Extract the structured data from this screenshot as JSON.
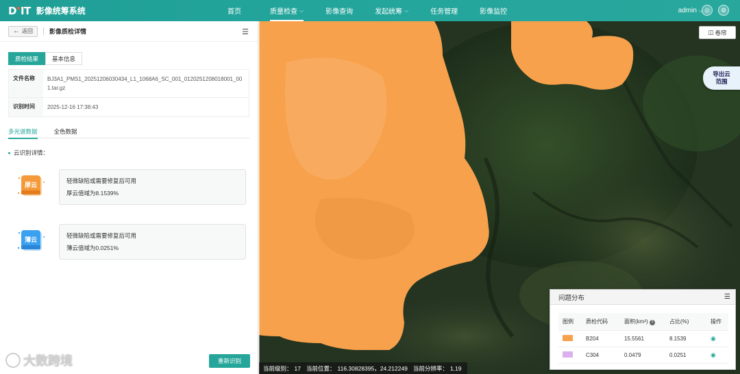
{
  "header": {
    "logo_text": "DIT",
    "app_title": "影像统筹系统",
    "nav": [
      {
        "label": "首页",
        "has_dropdown": false,
        "active": false
      },
      {
        "label": "质量检查",
        "has_dropdown": true,
        "active": true
      },
      {
        "label": "影像查询",
        "has_dropdown": false,
        "active": false
      },
      {
        "label": "发起统筹",
        "has_dropdown": true,
        "active": false
      },
      {
        "label": "任务管理",
        "has_dropdown": false,
        "active": false
      },
      {
        "label": "影像监控",
        "has_dropdown": false,
        "active": false
      }
    ],
    "user": "admin",
    "icons": [
      "message-icon",
      "settings-icon"
    ]
  },
  "left_panel": {
    "back_label": "返回",
    "title": "影像质检详情",
    "tabs": [
      "质检结果",
      "基本信息"
    ],
    "active_tab": "质检结果",
    "info": [
      {
        "key": "文件名称",
        "value": "BJ3A1_PMS1_20251206030434_L1_1068A6_SC_001_0120251208018001_001.tar.gz"
      },
      {
        "key": "识别时间",
        "value": "2025-12-16 17:38:43"
      }
    ],
    "data_tabs": [
      "多光谱数据",
      "全色数据"
    ],
    "active_data_tab": "多光谱数据",
    "section_label": "云识别详情：",
    "cloud_cards": [
      {
        "icon_label": "厚云",
        "icon_color": "#f59a3a",
        "title": "轻微缺陷或需要修复后可用",
        "desc": "厚云值域为8.1539%"
      },
      {
        "icon_label": "薄云",
        "icon_color": "#3aa0f0",
        "title": "轻微缺陷或需要修复后可用",
        "desc": "薄云值域为0.0251%"
      }
    ],
    "watermark": "大数跨境",
    "rerun_label": "重新识别"
  },
  "map": {
    "scroll_label": "卷帘",
    "export_label_1": "导出云",
    "export_label_2": "范围",
    "status": {
      "level_label": "当前级别：",
      "level_value": "17",
      "position_label": "当前位置：",
      "position_value": "116.30828395，24.212249",
      "resolution_label": "当前分辨率：",
      "resolution_value": "1.19"
    },
    "cloud_color": "#f7a14c",
    "issue_panel": {
      "title": "问题分布",
      "columns": [
        "图例",
        "质检代码",
        "面积(km²)",
        "占比(%)",
        "操作"
      ],
      "rows": [
        {
          "color": "#f7a14c",
          "code": "B204",
          "area": "15.5561",
          "ratio": "8.1539"
        },
        {
          "color": "#dcb0ef",
          "code": "C304",
          "area": "0.0479",
          "ratio": "0.0251"
        }
      ]
    }
  }
}
